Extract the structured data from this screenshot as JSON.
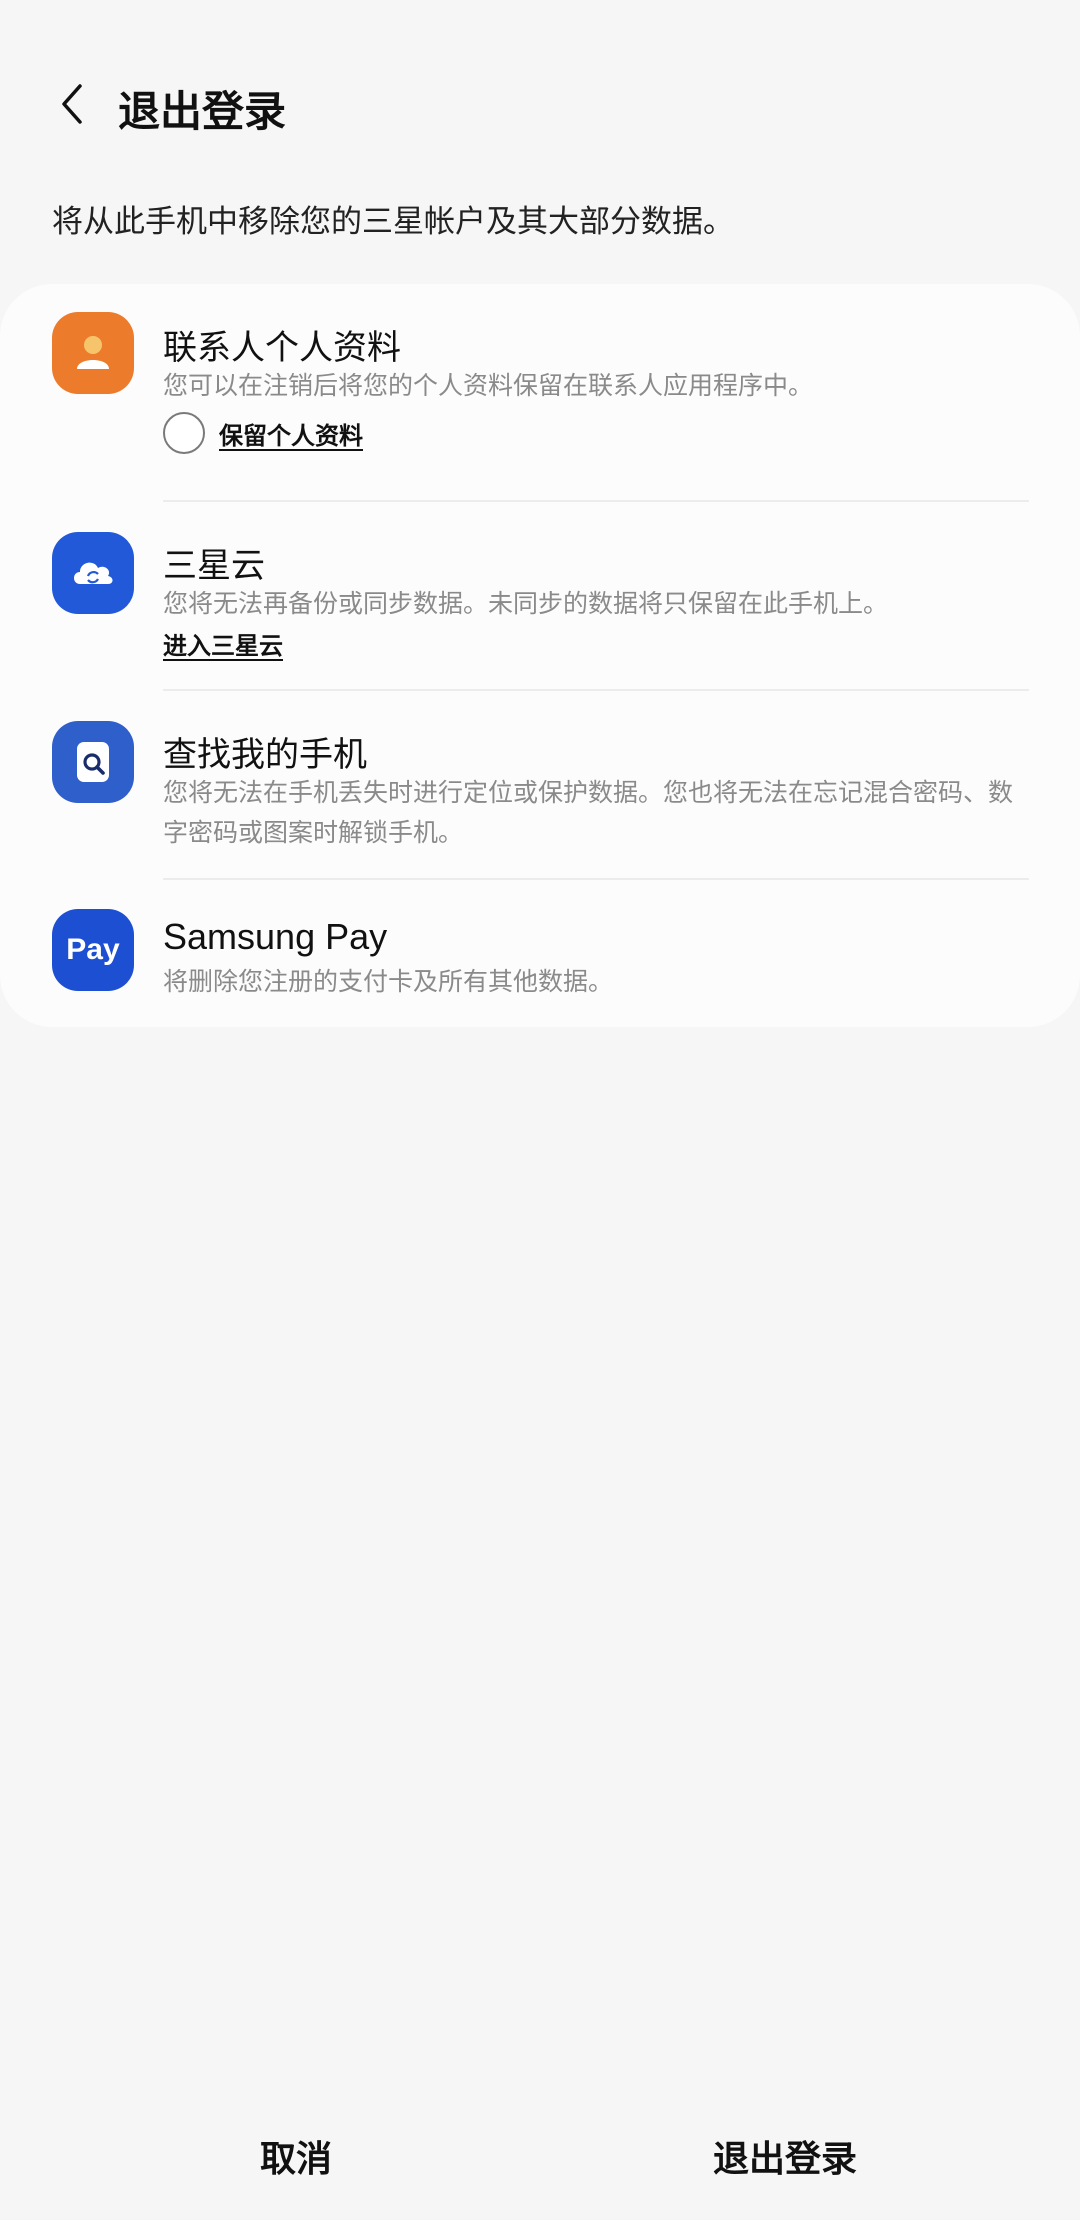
{
  "header": {
    "back_icon": "chevron-left-icon",
    "title": "退出登录"
  },
  "intro_text": "将从此手机中移除您的三星帐户及其大部分数据。",
  "items": [
    {
      "icon": "contact-person-icon",
      "icon_color": "#ec7b2c",
      "title": "联系人个人资料",
      "description": "您可以在注销后将您的个人资料保留在联系人应用程序中。",
      "checkbox_label": "保留个人资料",
      "checkbox_checked": false
    },
    {
      "icon": "cloud-sync-icon",
      "icon_color": "#2259d9",
      "title": "三星云",
      "description": "您将无法再备份或同步数据。未同步的数据将只保留在此手机上。",
      "link_label": "进入三星云"
    },
    {
      "icon": "find-phone-search-icon",
      "icon_color": "#2f5fcb",
      "title": "查找我的手机",
      "description": "您将无法在手机丢失时进行定位或保护数据。您也将无法在忘记混合密码、数字密码或图案时解锁手机。"
    },
    {
      "icon": "samsung-pay-icon",
      "icon_color": "#1d4fd3",
      "icon_text": "Pay",
      "title": "Samsung Pay",
      "description": "将删除您注册的支付卡及所有其他数据。"
    }
  ],
  "footer": {
    "cancel_label": "取消",
    "sign_out_label": "退出登录"
  }
}
